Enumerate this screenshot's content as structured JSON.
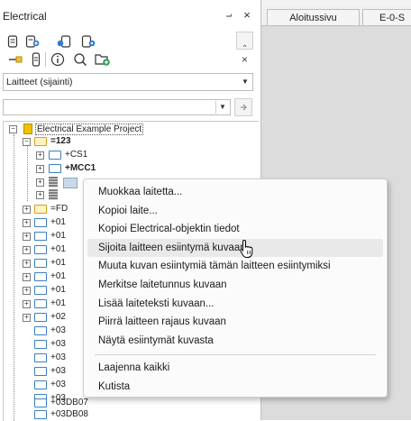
{
  "panel": {
    "title": "Electrical",
    "pin_glyph": "⨼",
    "close_glyph": "×",
    "side_collapse_glyph": "‸",
    "side_close_glyph": "×",
    "view_combo_value": "Laitteet (sijainti)",
    "filter_value": "",
    "combo_arrow": "▼"
  },
  "tabs": [
    {
      "label": "Aloitussivu"
    },
    {
      "label": "E-0-S"
    }
  ],
  "tree": {
    "root": "Electrical Example Project",
    "nodes": {
      "n123": "=123",
      "cs1": "+CS1",
      "mcc1": "+MCC1",
      "fd": "=FD",
      "r01a": "+01",
      "r01b": "+01",
      "r01c": "+01",
      "r01d": "+01",
      "r01e": "+01",
      "r01f": "+01",
      "r01g": "+01",
      "r02": "+02",
      "r03a": "+03",
      "r03b": "+03",
      "r03c": "+03",
      "r03d": "+03",
      "r03e": "+03",
      "r03f": "+03",
      "db07": "+03DB07",
      "db08": "+03DB08"
    },
    "expand_plus": "+",
    "expand_minus": "−"
  },
  "context_menu": {
    "items": [
      "Muokkaa laitetta...",
      "Kopioi laite...",
      "Kopioi Electrical-objektin tiedot",
      "Sijoita laitteen esiintymä kuvaan",
      "Muuta kuvan esiintymiä tämän laitteen esiintymiksi",
      "Merkitse laitetunnus kuvaan",
      "Lisää laiteteksti kuvaan...",
      "Piirrä laitteen rajaus kuvaan",
      "Näytä esiintymät kuvasta",
      "Laajenna kaikki",
      "Kutista"
    ],
    "hovered_index": 3
  },
  "icons": {
    "toolbar_row1": [
      "device-list-icon",
      "add-device-icon",
      "device-link-icon",
      "device-settings-icon"
    ],
    "toolbar_row2": [
      "cable-icon",
      "terminal-icon",
      "info-icon",
      "search-icon",
      "new-folder-icon"
    ]
  },
  "colors": {
    "folder_blue": "#3c7fc5",
    "folder_yellow": "#d4a017",
    "hover_bg": "#e9e9e9",
    "doc_area": "#dcdcdc"
  }
}
